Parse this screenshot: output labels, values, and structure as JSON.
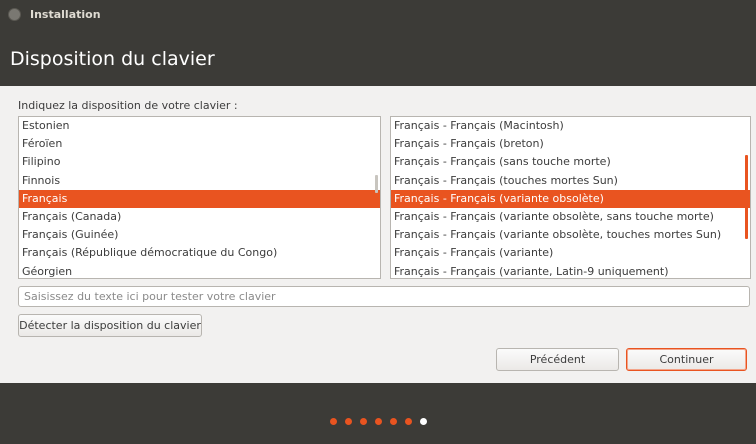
{
  "window": {
    "title": "Installation"
  },
  "header": {
    "title": "Disposition du clavier"
  },
  "prompt": "Indiquez la disposition de votre clavier :",
  "layouts": {
    "items": [
      "Estonien",
      "Féroïen",
      "Filipino",
      "Finnois",
      "Français",
      "Français (Canada)",
      "Français (Guinée)",
      "Français (République démocratique du Congo)",
      "Géorgien"
    ],
    "selected": "Français"
  },
  "variants": {
    "items": [
      "Français - Français (Macintosh)",
      "Français - Français (breton)",
      "Français - Français (sans touche morte)",
      "Français - Français (touches mortes Sun)",
      "Français - Français (variante obsolète)",
      "Français - Français (variante obsolète, sans touche morte)",
      "Français - Français (variante obsolète, touches mortes Sun)",
      "Français - Français (variante)",
      "Français - Français (variante, Latin-9 uniquement)"
    ],
    "selected": "Français - Français (variante obsolète)"
  },
  "test_input": {
    "placeholder": "Saisissez du texte ici pour tester votre clavier",
    "value": ""
  },
  "buttons": {
    "detect": "Détecter la disposition du clavier",
    "previous": "Précédent",
    "continue": "Continuer"
  },
  "progress": {
    "total_steps": 7,
    "current_step": 7,
    "completed_color": "#e95420",
    "current_color": "#ffffff"
  },
  "colors": {
    "accent": "#e95420",
    "header_bg": "#3c3b37",
    "window_bg": "#f2f1f0"
  }
}
